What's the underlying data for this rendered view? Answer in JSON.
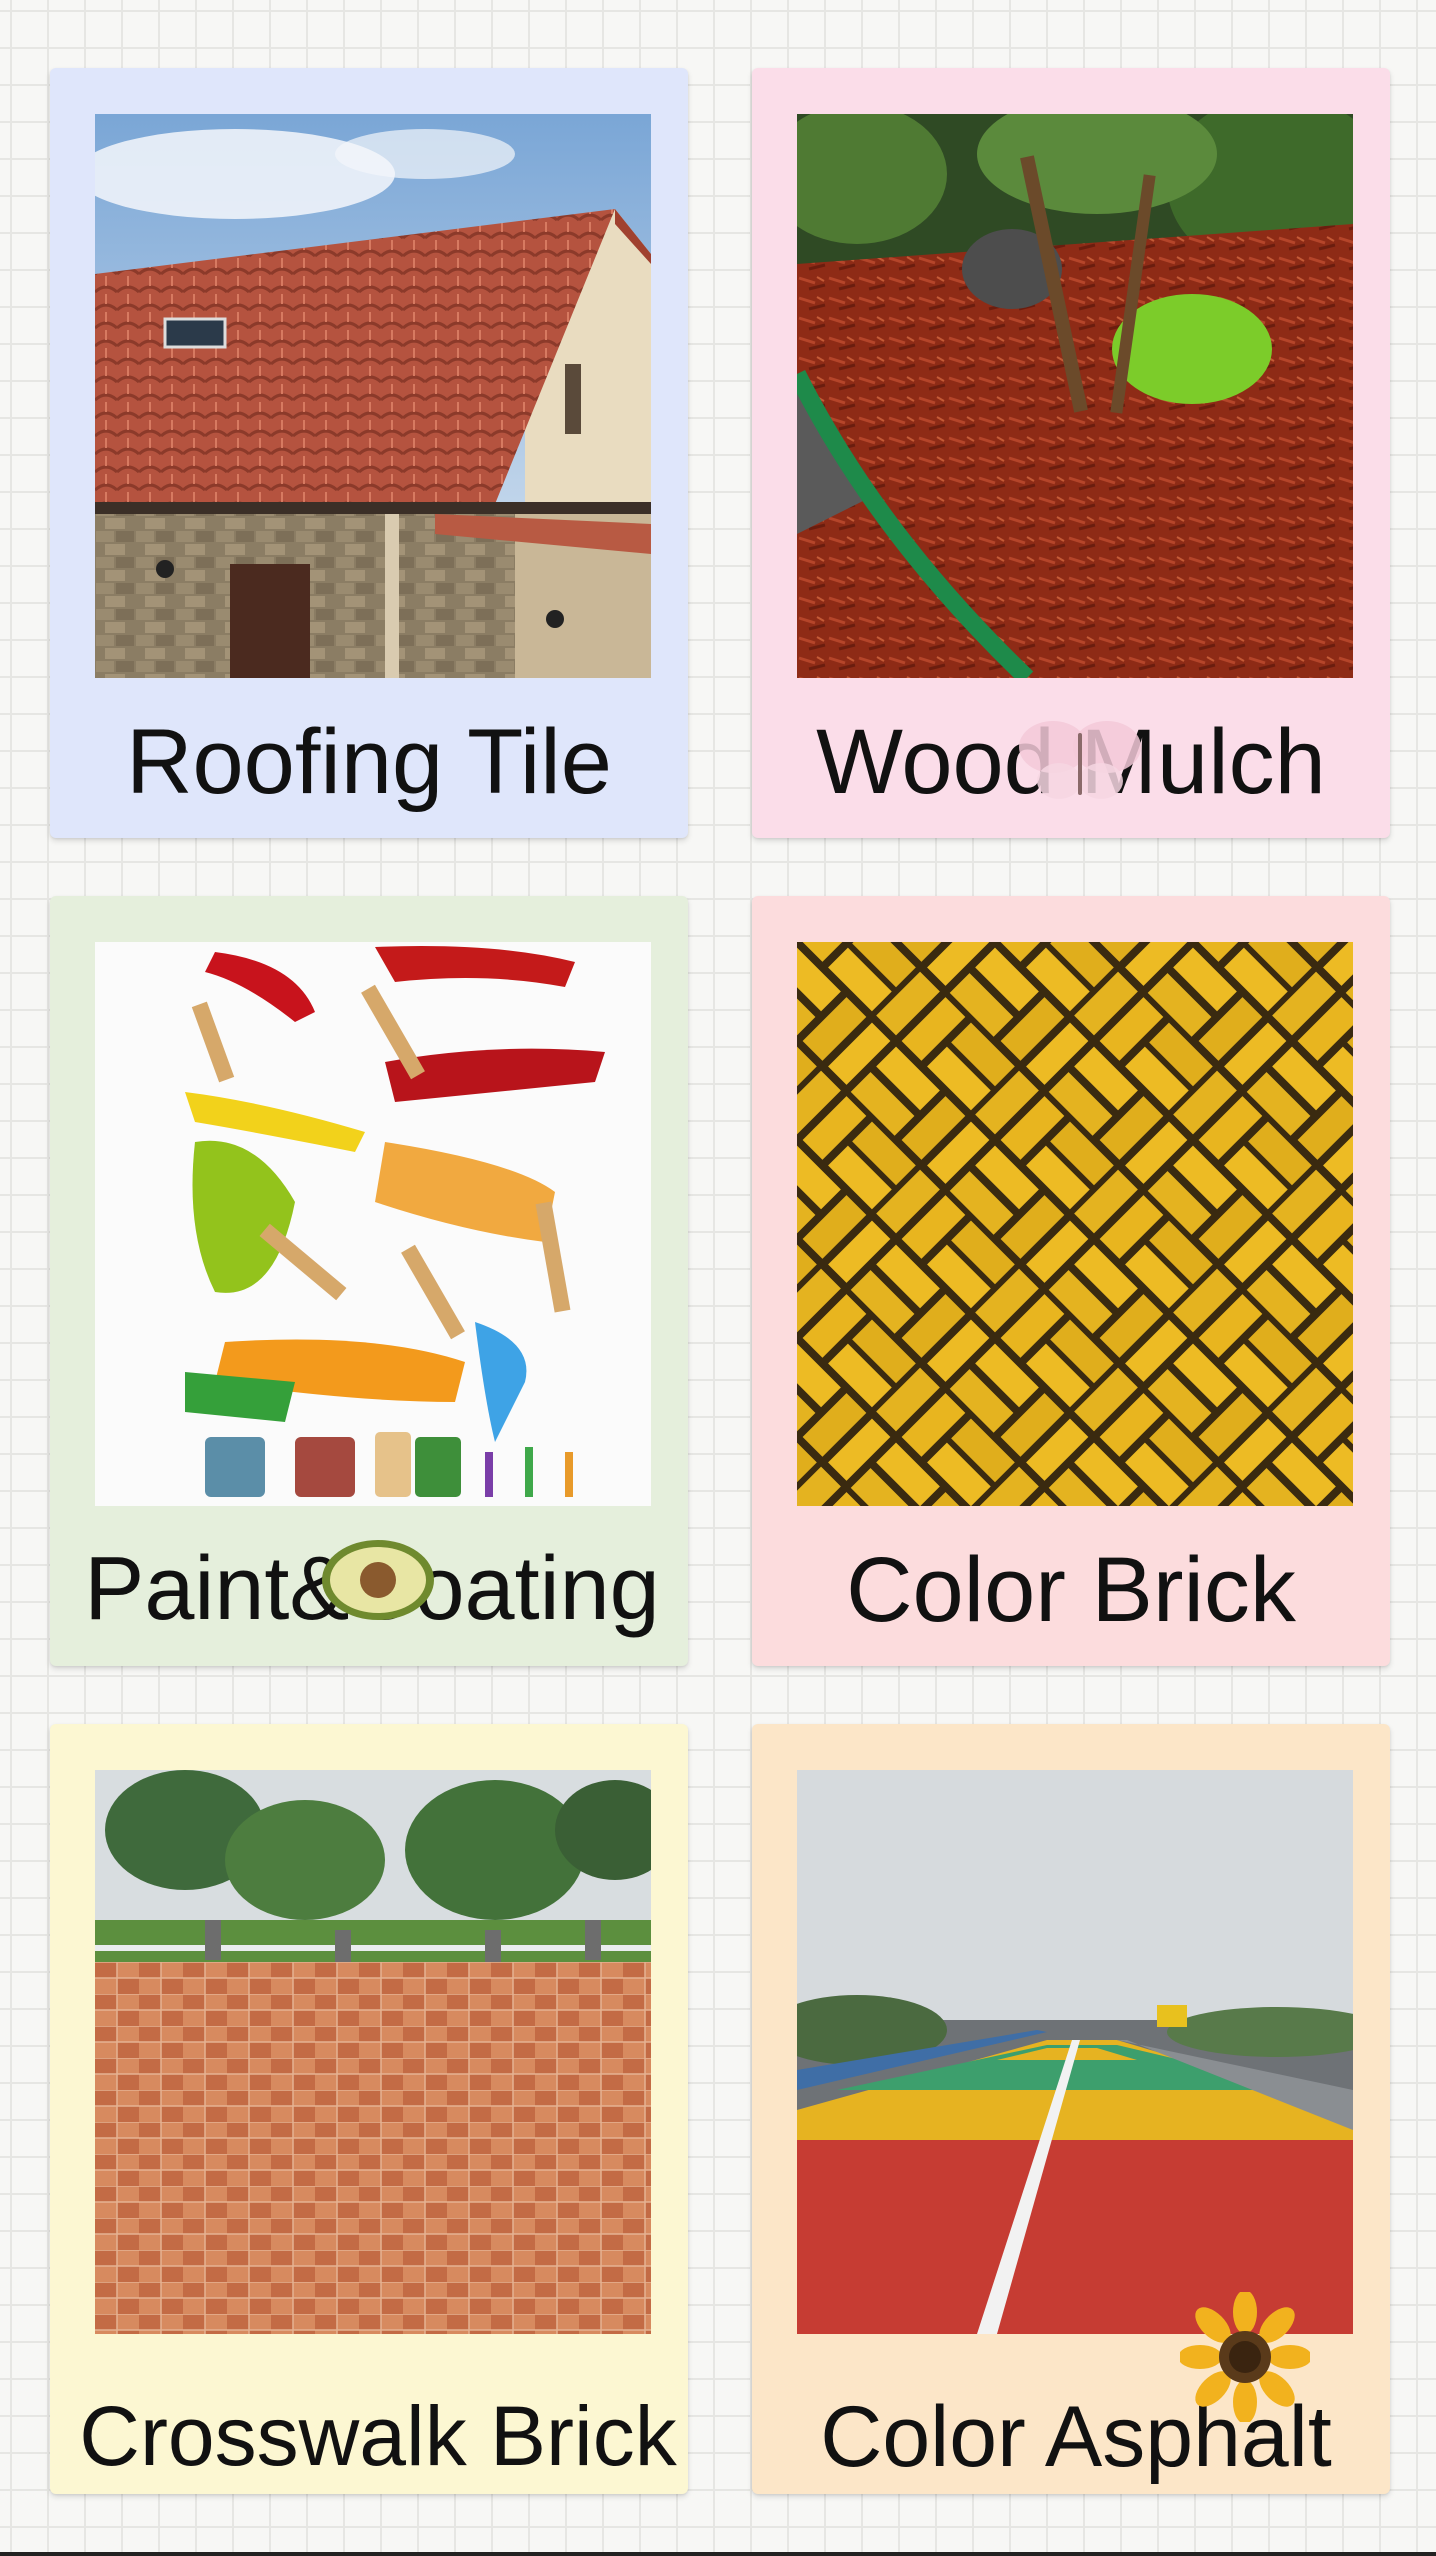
{
  "cards": [
    {
      "title": "Roofing Tile",
      "image": "roof-tile-house-photo"
    },
    {
      "title": "Wood Mulch",
      "image": "red-wood-mulch-garden-photo"
    },
    {
      "title": "Paint&Coating",
      "image": "paint-brushes-illustration"
    },
    {
      "title": "Color Brick",
      "image": "yellow-herringbone-brick-photo"
    },
    {
      "title": "Crosswalk Brick",
      "image": "checkered-paving-plaza-photo"
    },
    {
      "title": "Color Asphalt",
      "image": "colored-asphalt-road-photo"
    }
  ],
  "stickers": [
    "butterfly-icon",
    "avocado-icon",
    "sunflower-icon"
  ],
  "colors": {
    "background": "#f7f7f5",
    "card_blue": "#dfe6fb",
    "card_pink": "#fbdde9",
    "card_green": "#e5efdc",
    "card_rose": "#fcdcdd",
    "card_yellow": "#fcf7d2",
    "card_peach": "#fce6c8"
  }
}
